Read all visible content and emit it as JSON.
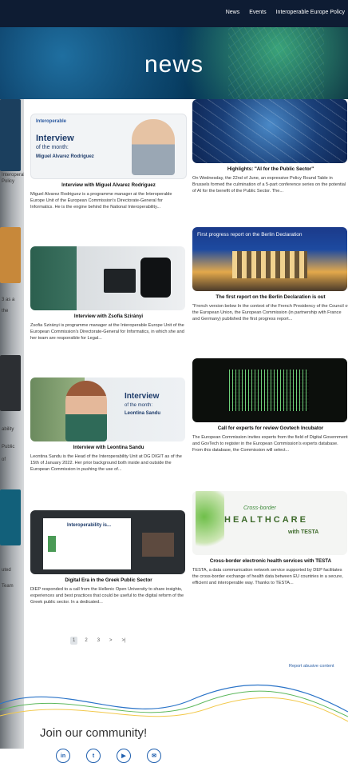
{
  "topnav": [
    "News",
    "Events",
    "Interoperable Europe Policy"
  ],
  "hero": {
    "title": "news"
  },
  "cards_left": [
    {
      "image": {
        "kicker": "Interoperable",
        "line1": "Interview",
        "line2": "of the month:",
        "name": "Miguel Alvarez Rodriguez"
      },
      "title": "Interview with Miguel Alvarez Rodriguez",
      "desc": "Miguel Alvarez Rodriguez is a programme manager at the Interoperable Europe Unit of the European Commission's Directorate-General for Informatics. He is the engine behind the National Interoperability..."
    },
    {
      "title": "Interview with Zsofia Szirányi",
      "desc": "Zsofia Szirányi is programme manager at the Interoperable Europe Unit of the European Commission's Directorate-General for Informatics, in which she and her team are responsible for Legal..."
    },
    {
      "image": {
        "line1": "Interview",
        "line2": "of the month:",
        "name": "Leontina Sandu"
      },
      "title": "Interview with Leontina Sandu",
      "desc": "Leontina Sandu is the Head of the Interoperability Unit at DG DIGIT as of the 15th of January 2022. Her prior background both inside and outside the European Commission in pushing the use of..."
    },
    {
      "image": {
        "slide": "Interoperability is..."
      },
      "title": "Digital Era in the Greek Public Sector",
      "desc": "DIEP responded to a call from the Hellenic Open University to share insights, experiences and best practices that could be useful to the digital reform of the Greek public sector. In a dedicated..."
    }
  ],
  "cards_right": [
    {
      "title": "Highlights: \"AI for the Public Sector\"",
      "desc": "On Wednesday, the 22nd of June, an expressive Policy Round Table in Brussels formed the culmination of a 5-part conference series on the potential of AI for the benefit of the Public Sector. The..."
    },
    {
      "image": {
        "banner": "First progress report on the Berlin Declaration"
      },
      "title": "The first report on the Berlin Declaration is out",
      "desc": "\"French version below In the context of the French Presidency of the Council of the European Union, the European Commission (in partnership with France and Germany) published the first progress report..."
    },
    {
      "title": "Call for experts for review Govtech Incubator",
      "desc": "The European Commission invites experts from the field of Digital Government and GovTech to register in the European Commission's experts database. From this database, the Commission will select..."
    },
    {
      "image": {
        "line1": "Cross-border",
        "line2": "HEALTHCARE",
        "line3": "with TESTA"
      },
      "title": "Cross-border electronic health services with TESTA",
      "desc": "TESTA, a data communication network service supported by DEP facilitates the cross-border exchange of health data between EU countries in a secure, efficient and interoperable way. Thanks to TESTA..."
    }
  ],
  "pagination": {
    "pages": [
      "1",
      "2",
      "3"
    ],
    "next": ">",
    "last": ">|"
  },
  "report_link": "Report abusive content",
  "community_title": "Join our community!",
  "social": [
    "in",
    "t",
    "▶",
    "✉"
  ],
  "sidebar_fragments": [
    "Interoperable",
    "Policy",
    "3 as a",
    "the",
    "ability",
    "Public",
    "of",
    "uted",
    "Team"
  ],
  "colors": {
    "topbar": "#0e1c33",
    "accent": "#1f5fae",
    "link": "#2a5fa5"
  }
}
